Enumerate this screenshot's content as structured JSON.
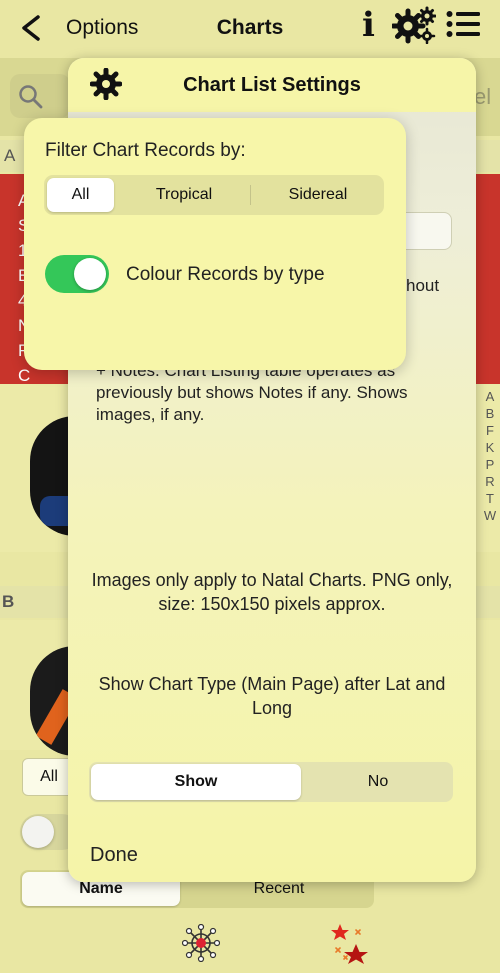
{
  "navbar": {
    "back_label": "Options",
    "title": "Charts"
  },
  "search": {
    "partial_text": "el"
  },
  "sections": {
    "a": "A",
    "b": "B"
  },
  "row_letters": [
    "A",
    "S",
    "1",
    "E",
    "4",
    "N",
    "F",
    "C"
  ],
  "index_letters": [
    "A",
    "B",
    "F",
    "K",
    "P",
    "R",
    "T",
    "W"
  ],
  "bottom": {
    "all_label": "All",
    "sort_options": [
      "Name",
      "Recent"
    ],
    "selected_sort": "Name"
  },
  "settings_panel": {
    "title": "Chart List Settings",
    "partial_text": "hout",
    "notes_text": "+ Notes. Chart Listing table operates as previously but shows Notes if any. Shows images, if any.",
    "images_text": "Images only apply to Natal Charts. PNG only, size: 150x150 pixels approx.",
    "charttype_text": "Show Chart Type (Main Page) after Lat and Long",
    "show_options": [
      "Show",
      "No"
    ],
    "selected_show": "Show",
    "done_label": "Done"
  },
  "filter_popover": {
    "title": "Filter Chart Records by:",
    "options": [
      "All",
      "Tropical",
      "Sidereal"
    ],
    "selected": "All",
    "colour_toggle_label": "Colour Records by type",
    "colour_toggle_on": true
  },
  "colors": {
    "accent_green": "#34c759",
    "row_red": "#c8342b",
    "background": "#e9e7a3"
  }
}
